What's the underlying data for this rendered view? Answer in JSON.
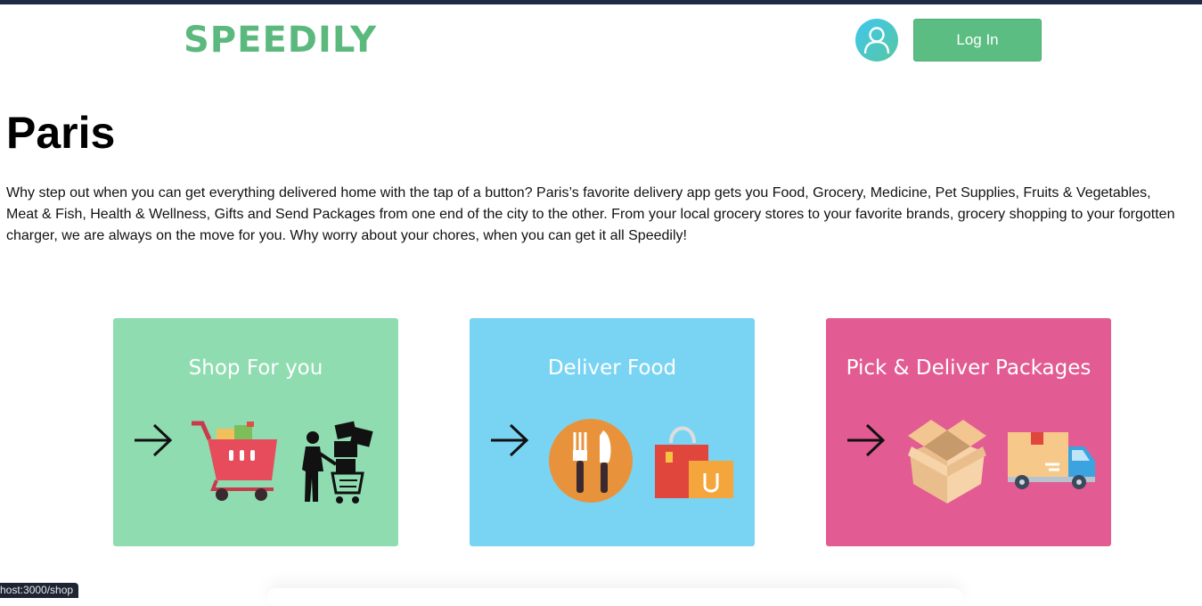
{
  "header": {
    "logo": "SPEEDILY",
    "login_label": "Log In"
  },
  "main": {
    "city": "Paris",
    "intro": "Why step out when you can get everything delivered home with the tap of a button? Paris’s favorite delivery app gets you Food, Grocery, Medicine, Pet Supplies, Fruits & Vegetables, Meat & Fish, Health & Wellness, Gifts and Send Packages from one end of the city to the other. From your local grocery stores to your favorite brands, grocery shopping to your forgotten charger, we are always on the move for you. Why worry about your chores, when you can get it all Speedily!",
    "cards": [
      {
        "title": "Shop For you",
        "color": "#8edcb0"
      },
      {
        "title": "Deliver Food",
        "color": "#79d4f3"
      },
      {
        "title": "Pick & Deliver Packages",
        "color": "#e25b93"
      }
    ]
  },
  "status_bar": {
    "url": "host:3000/shop"
  },
  "colors": {
    "brand": "#5cb97e",
    "topbar": "#1f2a44"
  }
}
